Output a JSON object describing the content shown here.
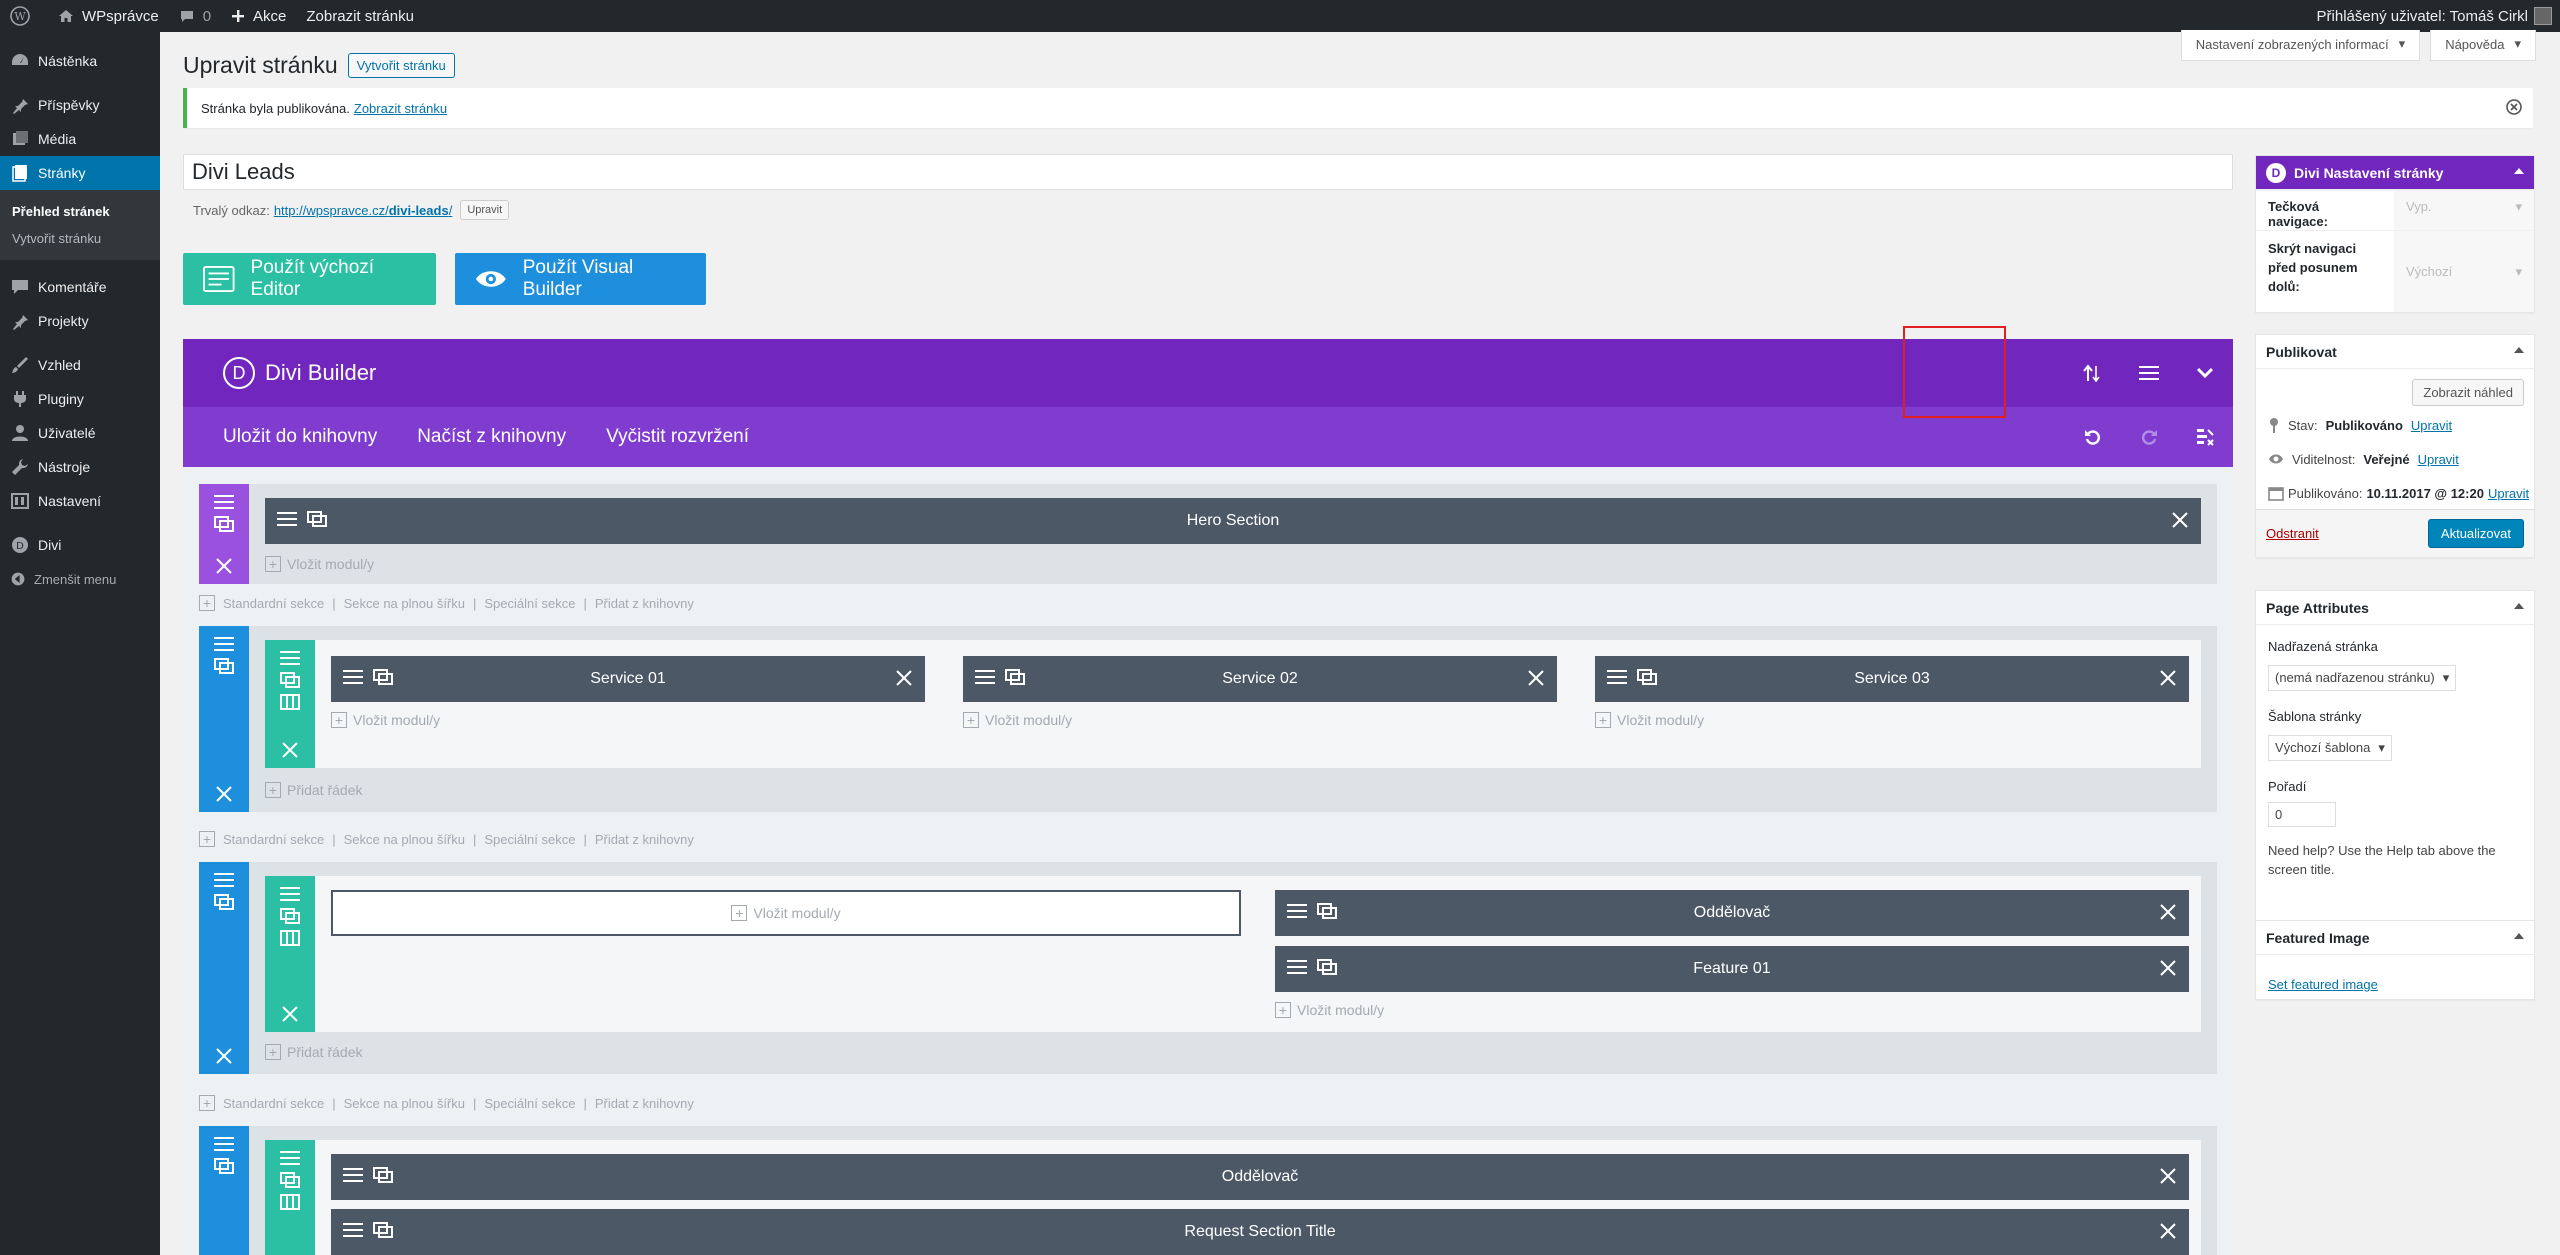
{
  "adminbar": {
    "site_name": "WPsprávce",
    "comments_count": "0",
    "new_label": "Akce",
    "view_page": "Zobrazit stránku",
    "user_greeting": "Přihlášený uživatel: Tomáš Cirkl"
  },
  "menu": {
    "items": [
      {
        "label": "Nástěnka"
      },
      {
        "label": "Příspěvky"
      },
      {
        "label": "Média"
      },
      {
        "label": "Stránky"
      },
      {
        "label": "Komentáře"
      },
      {
        "label": "Projekty"
      },
      {
        "label": "Vzhled"
      },
      {
        "label": "Pluginy"
      },
      {
        "label": "Uživatelé"
      },
      {
        "label": "Nástroje"
      },
      {
        "label": "Nastavení"
      },
      {
        "label": "Divi"
      },
      {
        "label": "Zmenšit menu"
      }
    ],
    "submenu": [
      "Přehled stránek",
      "Vytvořit stránku"
    ]
  },
  "screen_tabs": {
    "options": "Nastavení zobrazených informací",
    "help": "Nápověda"
  },
  "page": {
    "title": "Upravit stránku",
    "add_new": "Vytvořit stránku",
    "notice_text": "Stránka byla publikována.",
    "notice_link": "Zobrazit stránku",
    "post_title": "Divi Leads",
    "permalink_label": "Trvalý odkaz:",
    "permalink_url_base": "http://wpspravce.cz/",
    "permalink_slug": "divi-leads",
    "permalink_edit": "Upravit",
    "btn_default_editor": "Použít výchozí Editor",
    "btn_visual_builder": "Použít Visual Builder"
  },
  "builder": {
    "title": "Divi Builder",
    "logo_letter": "D",
    "toolbar": [
      "Uložit do knihovny",
      "Načíst z knihovny",
      "Vyčistit rozvržení"
    ],
    "insert_module": "Vložit modul/y",
    "add_row": "Přidat řádek",
    "add_links": [
      "Standardní sekce",
      "Sekce na plnou šířku",
      "Speciální sekce",
      "Přidat z knihovny"
    ],
    "modules": {
      "hero": "Hero Section",
      "service1": "Service 01",
      "service2": "Service 02",
      "service3": "Service 03",
      "divider": "Oddělovač",
      "feature1": "Feature 01",
      "divider2": "Oddělovač",
      "request": "Request Section Title"
    }
  },
  "sidebar": {
    "divi_box": {
      "title": "Divi Nastavení stránky",
      "logo_letter": "D",
      "dot_nav_label": "Tečková navigace:",
      "dot_nav_value": "Vyp.",
      "hide_nav_label": "Skrýt navigaci před posunem dolů:",
      "hide_nav_value": "Výchozí"
    },
    "publish": {
      "title": "Publikovat",
      "preview": "Zobrazit náhled",
      "status_label": "Stav:",
      "status_value": "Publikováno",
      "visibility_label": "Viditelnost:",
      "visibility_value": "Veřejné",
      "published_label": "Publikováno:",
      "published_value": "10.11.2017 @ 12:20",
      "edit": "Upravit",
      "delete": "Odstranit",
      "update": "Aktualizovat"
    },
    "attributes": {
      "title": "Page Attributes",
      "parent_label": "Nadřazená stránka",
      "parent_value": "(nemá nadřazenou stránku)",
      "template_label": "Šablona stránky",
      "template_value": "Výchozí šablona",
      "order_label": "Pořadí",
      "order_value": "0",
      "help": "Need help? Use the Help tab above the screen title."
    },
    "featured": {
      "title": "Featured Image",
      "link": "Set featured image"
    }
  },
  "colors": {
    "divi_purple": "#7127bd",
    "toolbar_purple": "#7f3ccf",
    "section_blue": "#1e8fdc",
    "row_teal": "#2bc0a4",
    "module_dark": "#4c5866",
    "wp_blue": "#0073aa"
  }
}
